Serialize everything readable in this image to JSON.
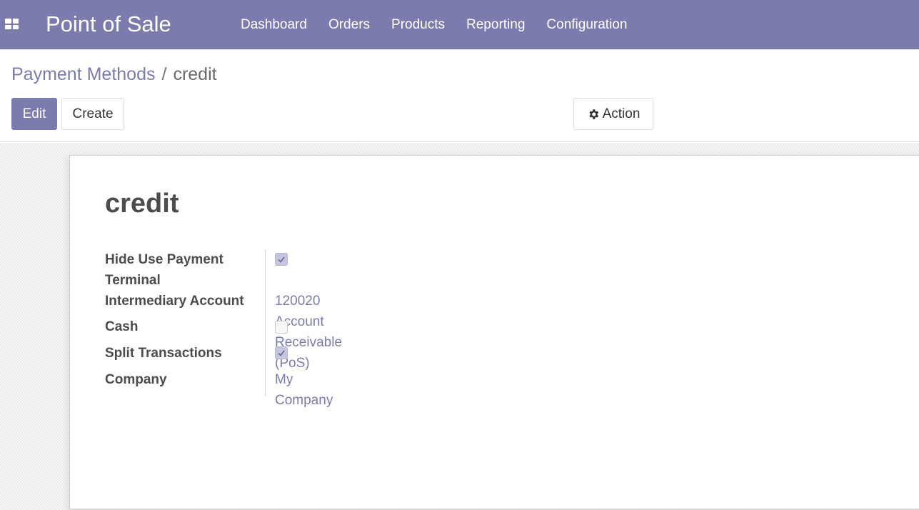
{
  "navbar": {
    "apps_icon": "grid-icon",
    "brand": "Point of Sale",
    "menu": [
      "Dashboard",
      "Orders",
      "Products",
      "Reporting",
      "Configuration"
    ],
    "color": "#7c7bad"
  },
  "breadcrumb": {
    "parent": "Payment Methods",
    "separator": "/",
    "current": "credit"
  },
  "buttons": {
    "edit": "Edit",
    "create": "Create",
    "action": "Action",
    "action_icon": "gear-icon"
  },
  "record": {
    "title": "credit",
    "fields": {
      "hide_use_payment_terminal": {
        "label_line1": "Hide Use Payment",
        "label_line2": "Terminal",
        "checked": true
      },
      "intermediary_account": {
        "label": "Intermediary Account",
        "value": "120020 Account Receivable (PoS)"
      },
      "cash": {
        "label": "Cash",
        "checked": false
      },
      "split_transactions": {
        "label": "Split Transactions",
        "checked": true
      },
      "company": {
        "label": "Company",
        "value": "My Company"
      }
    }
  }
}
